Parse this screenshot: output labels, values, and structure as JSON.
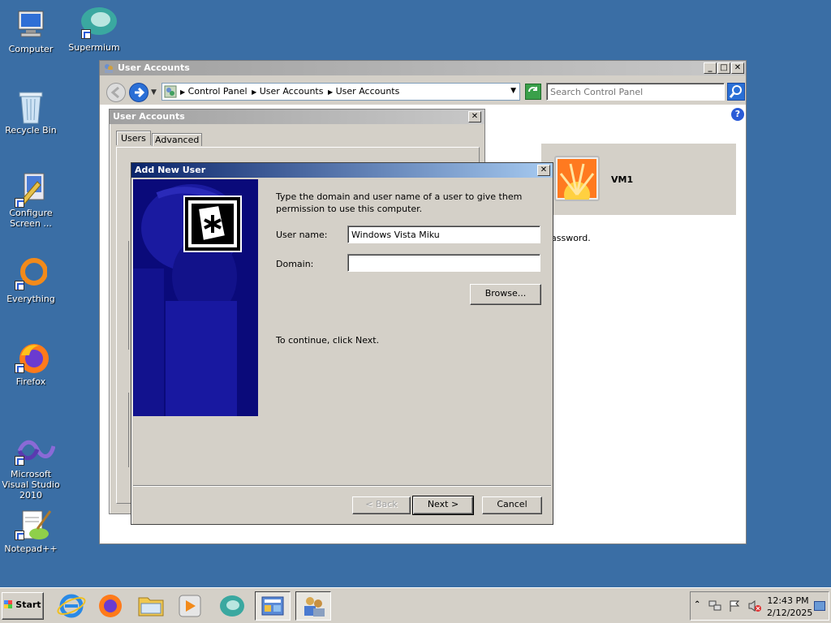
{
  "desktop": {
    "icons": [
      {
        "label": "Computer"
      },
      {
        "label": "Supermium"
      },
      {
        "label": "Recycle Bin"
      },
      {
        "label": "Configure Screen ..."
      },
      {
        "label": "Everything"
      },
      {
        "label": "Firefox"
      },
      {
        "label": "Microsoft Visual Studio 2010"
      },
      {
        "label": "Notepad++"
      }
    ]
  },
  "explorer": {
    "title": "User Accounts",
    "breadcrumb": [
      "Control Panel",
      "User Accounts",
      "User Accounts"
    ],
    "search_placeholder": "Search Control Panel",
    "user_name": "VM1",
    "partial_text": "assword."
  },
  "user_accounts_dialog": {
    "title": "User Accounts",
    "tabs": [
      "Users",
      "Advanced"
    ]
  },
  "add_user_dialog": {
    "title": "Add New User",
    "instructions": "Type the domain and user name of a user to give them permission to use this computer.",
    "username_label": "User name:",
    "username_value": "Windows Vista Miku",
    "domain_label": "Domain:",
    "domain_value": "",
    "browse_label": "Browse...",
    "continue_text": "To continue, click Next.",
    "back_label": "< Back",
    "next_label": "Next >",
    "cancel_label": "Cancel"
  },
  "taskbar": {
    "start_label": "Start",
    "time": "12:43 PM",
    "date": "2/12/2025"
  }
}
